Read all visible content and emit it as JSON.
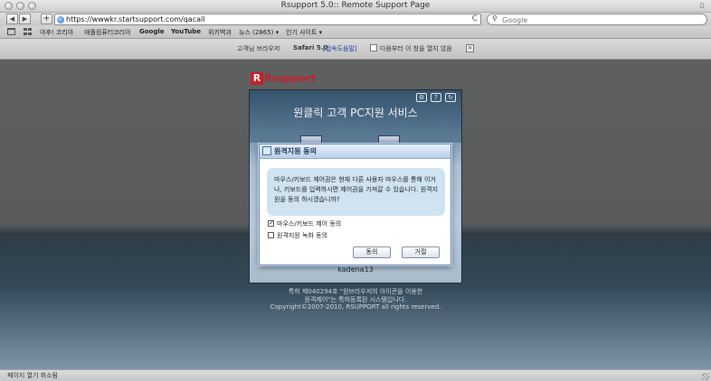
{
  "window": {
    "title": "Rsupport 5.0:: Remote Support Page"
  },
  "toolbar": {
    "back": "◀",
    "forward": "▶",
    "add": "+",
    "url": "https://wwwkr.startsupport.com/qacall",
    "reload": "C",
    "search_placeholder": "Google"
  },
  "bookmarks": [
    "야후! 코리아",
    "애플컴퓨터코리아",
    "Google",
    "YouTube",
    "위키백과",
    "뉴스 (2865) ▾",
    "인기 사이트 ▾"
  ],
  "notice": {
    "browser_label": "고객님 브라우저",
    "browser_version": "Safari 5.0",
    "help_link": "[접속도움말]",
    "hide_today": "다음부터 이 창을 열지 않음",
    "close": "×"
  },
  "logo": {
    "mark": "R",
    "text": "Rsupport"
  },
  "panel": {
    "title": "원클릭 고객 PC지원 서비스",
    "caption": "kadena13"
  },
  "dialog": {
    "title": "원격지원 동의",
    "message": "마우스/키보드 제어권은 현재 다른 사용자 마우스를 통해 이거나, 키보드를 입력하시면 제어권을 가져갈 수 있습니다. 원격지원을 동의 하시겠습니까?",
    "options": [
      {
        "label": "마우스/키보드 제어 동의",
        "checked": true
      },
      {
        "label": "원격지원 녹화 동의",
        "checked": false
      }
    ],
    "ok": "동의",
    "cancel": "거절"
  },
  "footer": {
    "line1": "특허 제040294호 \"원브라우저의 아이콘을 이용한",
    "line2": "원격제어\"는 특허등록된 시스템입니다.",
    "line3": "Copyright©2007-2010, RSUPPORT all rights reserved."
  },
  "status": {
    "text": "페이지 열기 취소됨"
  }
}
